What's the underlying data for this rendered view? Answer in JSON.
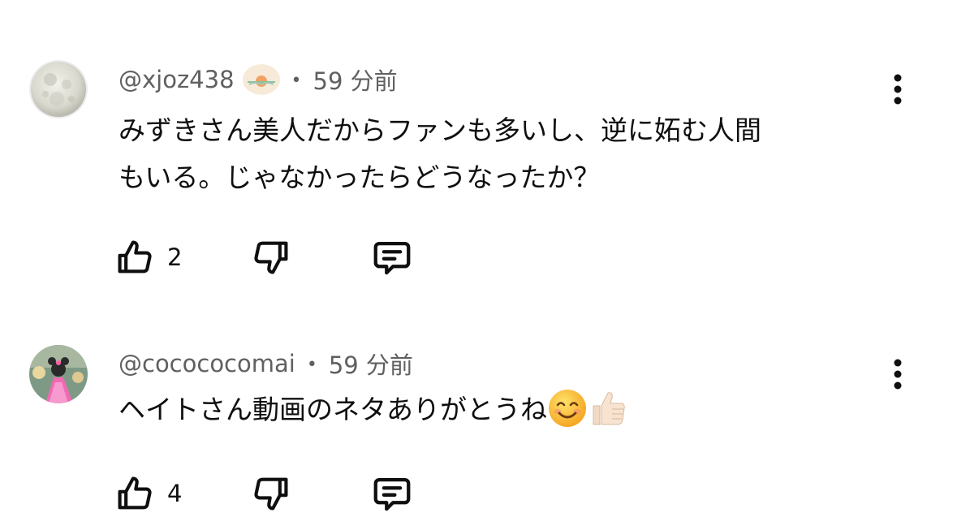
{
  "comments": [
    {
      "author": "@xjoz438",
      "separator": "•",
      "time": "59 分前",
      "text_lines": [
        "みずきさん美人だからファンも多いし、逆に妬む人間",
        "もいる。じゃなかったらどうなったか？"
      ],
      "likes": "2",
      "avatar_icon": "moon-avatar",
      "badge_icon": "sunrise-badge-icon"
    },
    {
      "author": "@cocococomai",
      "separator": "•",
      "time": "59 分前",
      "text_lines": [
        "ヘイトさん動画のネタありがとうね"
      ],
      "likes": "4",
      "avatar_icon": "pink-dress-avatar",
      "emojis": [
        "smiling-face-emoji",
        "thumbs-up-emoji"
      ]
    }
  ],
  "icons": {
    "like": "thumb-up-icon",
    "dislike": "thumb-down-icon",
    "reply": "comment-reply-icon",
    "more": "more-vertical-icon"
  },
  "colors": {
    "text_primary": "#0f0f0f",
    "text_secondary": "#606060"
  }
}
